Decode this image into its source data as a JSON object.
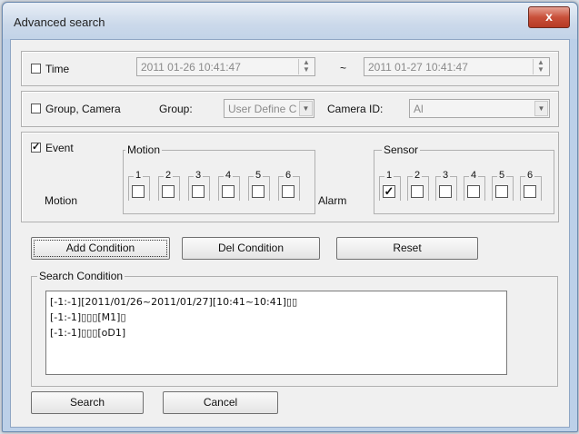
{
  "window": {
    "title": "Advanced search",
    "close_label": "x"
  },
  "time": {
    "label": "Time",
    "checked": false,
    "from": "2011 01-26 10:41:47",
    "separator": "~",
    "to": "2011 01-27 10:41:47"
  },
  "group_camera": {
    "label": "Group, Camera",
    "group_label": "Group:",
    "group_value": "User Define C",
    "camera_label": "Camera ID:",
    "camera_value": "Al"
  },
  "event": {
    "label": "Event",
    "checked": true,
    "motion_legend": "Motion",
    "motion_row_label": "Motion",
    "alarm_row_label": "Alarm",
    "sensor_legend": "Sensor",
    "motion_channels": [
      {
        "num": "1",
        "checked": false
      },
      {
        "num": "2",
        "checked": false
      },
      {
        "num": "3",
        "checked": false
      },
      {
        "num": "4",
        "checked": false
      },
      {
        "num": "5",
        "checked": false
      },
      {
        "num": "6",
        "checked": false
      }
    ],
    "sensor_channels": [
      {
        "num": "1",
        "checked": true
      },
      {
        "num": "2",
        "checked": false
      },
      {
        "num": "3",
        "checked": false
      },
      {
        "num": "4",
        "checked": false
      },
      {
        "num": "5",
        "checked": false
      },
      {
        "num": "6",
        "checked": false
      }
    ]
  },
  "buttons": {
    "add_condition": "Add Condition",
    "del_condition": "Del Condition",
    "reset": "Reset",
    "search": "Search",
    "cancel": "Cancel"
  },
  "search_condition": {
    "legend": "Search Condition",
    "items": [
      "[-1:-1][2011/01/26~2011/01/27][10:41~10:41]▯▯",
      "[-1:-1]▯▯▯[M1]▯",
      "[-1:-1]▯▯▯[oD1]"
    ]
  },
  "check_mark": "✓"
}
